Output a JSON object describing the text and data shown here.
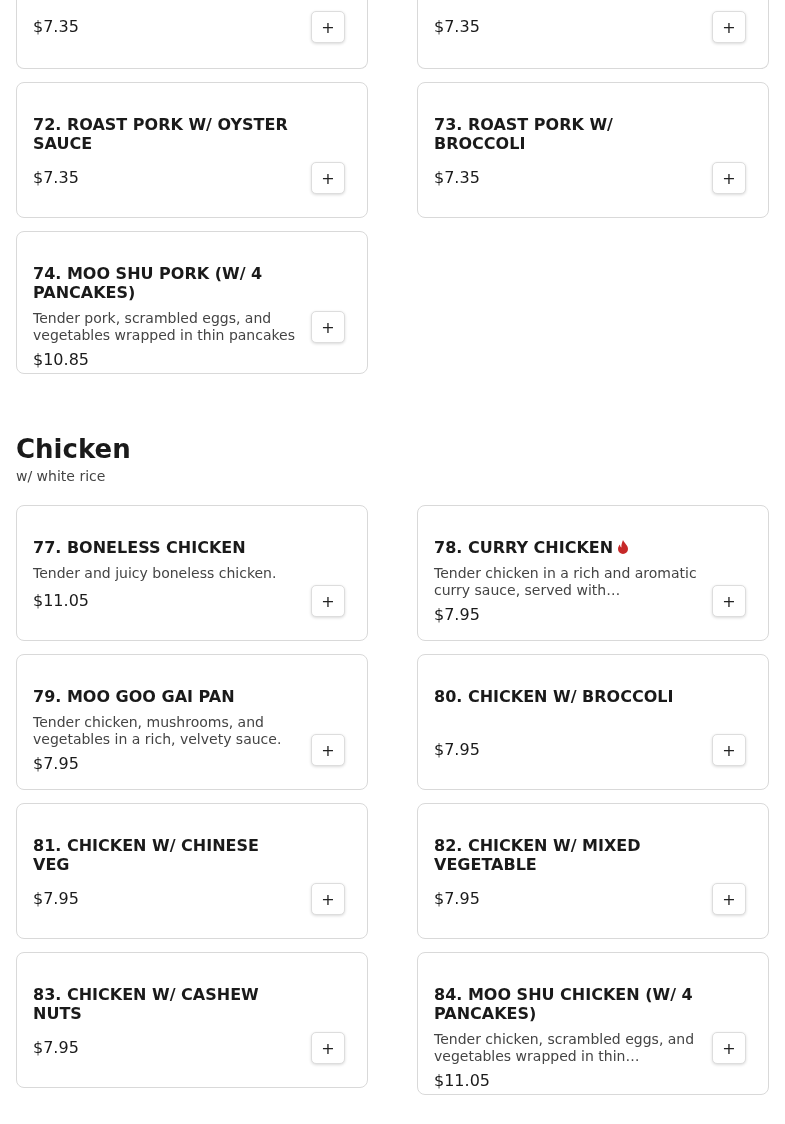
{
  "sections": [
    {
      "items": [
        {
          "kind": "partial",
          "price": "$7.35",
          "add_button": "+"
        },
        {
          "kind": "partial",
          "price": "$7.35",
          "add_button": "+"
        },
        {
          "kind": "full",
          "name": "72. ROAST PORK W/ OYSTER SAUCE",
          "price": "$7.35",
          "add_button": "+",
          "spicy": false
        },
        {
          "kind": "full",
          "name": "73. ROAST PORK W/ BROCCOLI",
          "price": "$7.35",
          "add_button": "+",
          "spicy": false
        },
        {
          "kind": "full",
          "name": "74. MOO SHU PORK (W/ 4 PANCAKES)",
          "description": "Tender pork, scrambled eggs, and vegetables wrapped in thin pancakes",
          "price": "$10.85",
          "add_button": "+",
          "spicy": false
        }
      ]
    },
    {
      "title": "Chicken",
      "subtitle": "w/ white rice",
      "items": [
        {
          "kind": "full",
          "name": "77. BONELESS CHICKEN",
          "description": "Tender and juicy boneless chicken.",
          "price": "$11.05",
          "add_button": "+",
          "spicy": false
        },
        {
          "kind": "full",
          "name": "78. CURRY CHICKEN",
          "description": "Tender chicken in a rich and aromatic curry sauce, served with…",
          "price": "$7.95",
          "add_button": "+",
          "spicy": true
        },
        {
          "kind": "full",
          "name": "79. MOO GOO GAI PAN",
          "description": "Tender chicken, mushrooms, and vegetables in a rich, velvety sauce.",
          "price": "$7.95",
          "add_button": "+",
          "spicy": false
        },
        {
          "kind": "full",
          "name": "80. CHICKEN W/ BROCCOLI",
          "price": "$7.95",
          "add_button": "+",
          "spicy": false
        },
        {
          "kind": "full",
          "name": "81. CHICKEN W/ CHINESE VEG",
          "price": "$7.95",
          "add_button": "+",
          "spicy": false
        },
        {
          "kind": "full",
          "name": "82. CHICKEN W/ MIXED VEGETABLE",
          "price": "$7.95",
          "add_button": "+",
          "spicy": false
        },
        {
          "kind": "full",
          "name": "83. CHICKEN W/ CASHEW NUTS",
          "price": "$7.95",
          "add_button": "+",
          "spicy": false
        },
        {
          "kind": "full",
          "name": "84. MOO SHU CHICKEN (W/ 4 PANCAKES)",
          "description": "Tender chicken, scrambled eggs, and vegetables wrapped in thin…",
          "price": "$11.05",
          "add_button": "+",
          "spicy": false
        }
      ]
    }
  ]
}
